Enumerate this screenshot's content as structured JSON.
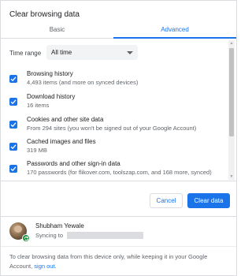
{
  "dialog": {
    "title": "Clear browsing data"
  },
  "tabs": [
    {
      "label": "Basic",
      "active": false
    },
    {
      "label": "Advanced",
      "active": true
    }
  ],
  "time_range": {
    "label": "Time range",
    "value": "All time"
  },
  "options": [
    {
      "title": "Browsing history",
      "description": "4,493 items (and more on synced devices)",
      "checked": true
    },
    {
      "title": "Download history",
      "description": "16 items",
      "checked": true
    },
    {
      "title": "Cookies and other site data",
      "description": "From 294 sites (you won't be signed out of your Google Account)",
      "checked": true
    },
    {
      "title": "Cached images and files",
      "description": "319 MB",
      "checked": true
    },
    {
      "title": "Passwords and other sign-in data",
      "description": "170 passwords (for flikover.com, toolszap.com, and 168 more, synced)",
      "checked": true
    }
  ],
  "buttons": {
    "cancel": "Cancel",
    "clear": "Clear data"
  },
  "account": {
    "name": "Shubham Yewale",
    "syncing_label": "Syncing to"
  },
  "footer": {
    "text": "To clear browsing data from this device only, while keeping it in your Google Account, ",
    "link": "sign out."
  },
  "colors": {
    "accent": "#1a73e8",
    "sync_green": "#1e8e3e"
  }
}
